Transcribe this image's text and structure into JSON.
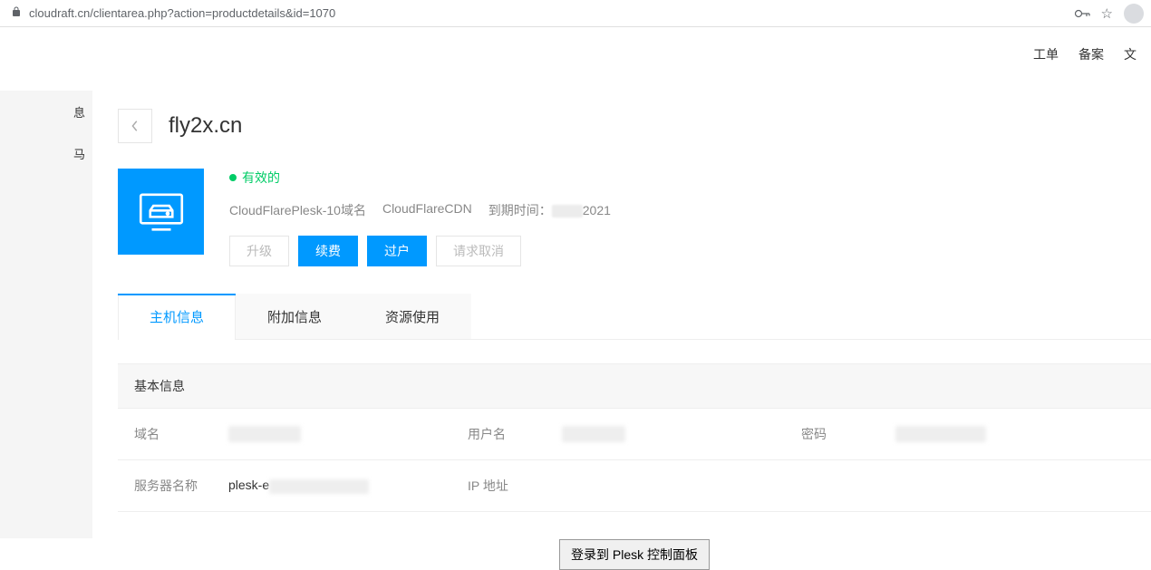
{
  "browser": {
    "url": "cloudraft.cn/clientarea.php?action=productdetails&id=1070"
  },
  "topnav": {
    "tickets": "工单",
    "beian": "备案",
    "docs": "文"
  },
  "sidebar": {
    "item1": "息",
    "item2": "马"
  },
  "page": {
    "title": "fly2x.cn"
  },
  "status": {
    "text": "有效的"
  },
  "meta": {
    "product": "CloudFlarePlesk-10域名",
    "cdn": "CloudFlareCDN",
    "expire_label": "到期时间：",
    "expire_year": "2021"
  },
  "actions": {
    "upgrade": "升级",
    "renew": "续费",
    "transfer": "过户",
    "cancel": "请求取消"
  },
  "tabs": [
    {
      "label": "主机信息",
      "active": true
    },
    {
      "label": "附加信息",
      "active": false
    },
    {
      "label": "资源使用",
      "active": false
    }
  ],
  "section": {
    "basic_title": "基本信息"
  },
  "fields": {
    "domain_label": "域名",
    "username_label": "用户名",
    "password_label": "密码",
    "server_label": "服务器名称",
    "server_value": "plesk-e",
    "ip_label": "IP 地址"
  },
  "footer": {
    "plesk_login": "登录到 Plesk 控制面板"
  }
}
